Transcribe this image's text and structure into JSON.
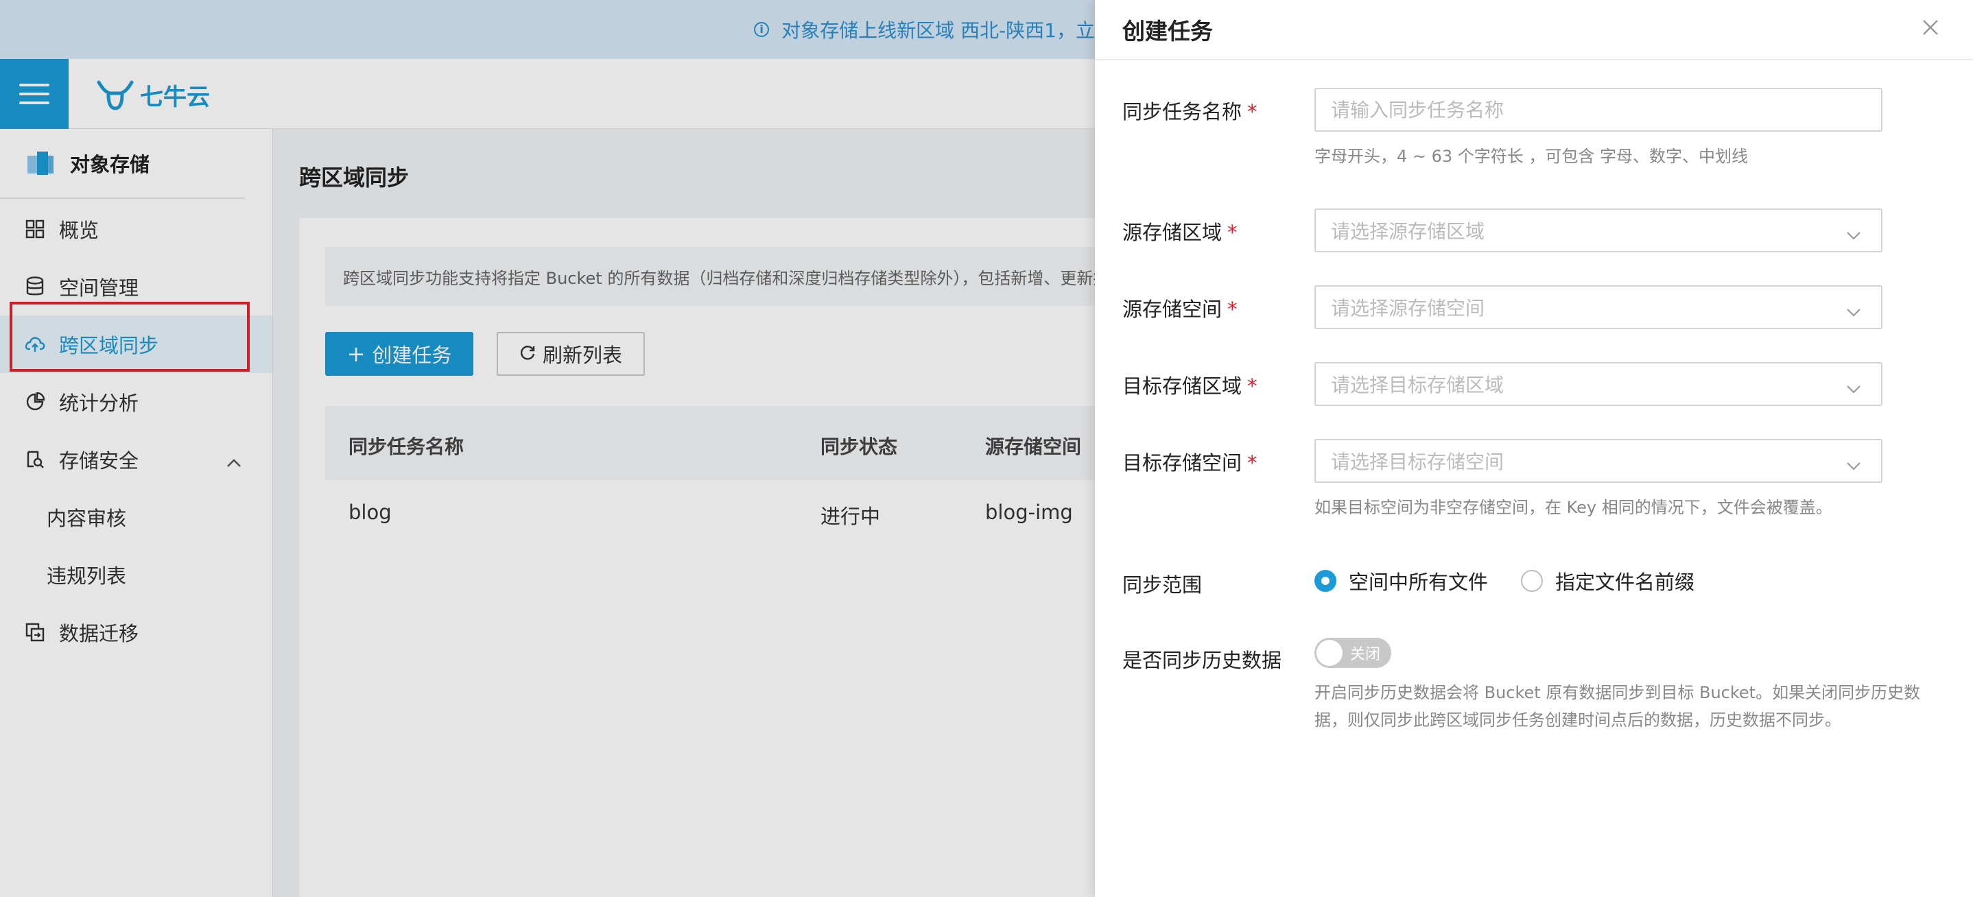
{
  "banner": {
    "text": "对象存储上线新区域 西北-陕西1，立"
  },
  "header": {
    "logo_text": "七牛云"
  },
  "sidebar": {
    "title": "对象存储",
    "items": [
      {
        "label": "概览"
      },
      {
        "label": "空间管理"
      },
      {
        "label": "跨区域同步"
      },
      {
        "label": "统计分析"
      },
      {
        "label": "存储安全"
      },
      {
        "label": "内容审核"
      },
      {
        "label": "违规列表"
      },
      {
        "label": "数据迁移"
      }
    ]
  },
  "main": {
    "title": "跨区域同步",
    "notice": "跨区域同步功能支持将指定 Bucket 的所有数据（归档存储和深度归档存储类型除外），包括新增、更新掉",
    "create_button": "创建任务",
    "refresh_button": "刷新列表",
    "table": {
      "columns": [
        "同步任务名称",
        "同步状态",
        "源存储空间"
      ],
      "rows": [
        [
          "blog",
          "进行中",
          "blog-img"
        ]
      ]
    }
  },
  "drawer": {
    "title": "创建任务",
    "fields": {
      "task_name": {
        "label": "同步任务名称",
        "placeholder": "请输入同步任务名称",
        "hint": "字母开头，4 ~ 63 个字符长 ，可包含 字母、数字、中划线"
      },
      "source_region": {
        "label": "源存储区域",
        "placeholder": "请选择源存储区域"
      },
      "source_bucket": {
        "label": "源存储空间",
        "placeholder": "请选择源存储空间"
      },
      "target_region": {
        "label": "目标存储区域",
        "placeholder": "请选择目标存储区域"
      },
      "target_bucket": {
        "label": "目标存储空间",
        "placeholder": "请选择目标存储空间",
        "hint": "如果目标空间为非空存储空间，在 Key 相同的情况下，文件会被覆盖。"
      }
    },
    "sync_scope": {
      "label": "同步范围",
      "options": [
        "空间中所有文件",
        "指定文件名前缀"
      ],
      "selected": "空间中所有文件"
    },
    "sync_history": {
      "label": "是否同步历史数据",
      "toggle_text": "关闭",
      "enabled": false,
      "hint_line1": "开启同步历史数据会将 Bucket 原有数据同步到目标 Bucket。如果关闭同步历史数",
      "hint_line2": "据，则仅同步此跨区域同步任务创建时间点后的数据，历史数据不同步。"
    }
  },
  "colors": {
    "accent": "#1a9ad6",
    "required": "#e0242e",
    "highlight": "#e0242e"
  }
}
